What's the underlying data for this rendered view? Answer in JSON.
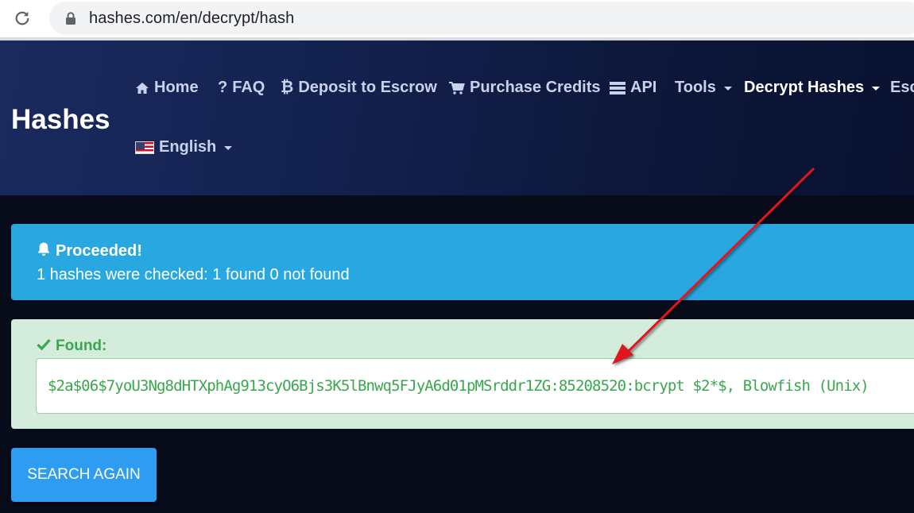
{
  "browser": {
    "url": "hashes.com/en/decrypt/hash"
  },
  "header": {
    "brand": "Hashes",
    "nav": [
      {
        "label": "Home",
        "icon": "home-icon"
      },
      {
        "label": "FAQ",
        "icon": "question-icon"
      },
      {
        "label": "Deposit to Escrow",
        "icon": "bitcoin-icon"
      },
      {
        "label": "Purchase Credits",
        "icon": "cart-icon"
      },
      {
        "label": "API",
        "icon": "server-icon"
      },
      {
        "label": "Tools",
        "dropdown": true
      },
      {
        "label": "Decrypt Hashes",
        "dropdown": true,
        "active": true
      },
      {
        "label": "Esc"
      }
    ],
    "language": {
      "label": "English",
      "icon": "us-flag-icon"
    }
  },
  "alert_info": {
    "title": "Proceeded!",
    "body": "1 hashes were checked: 1 found 0 not found",
    "icon": "bell-icon",
    "color": "#29a7e1"
  },
  "found": {
    "title": "Found:",
    "icon": "check-icon",
    "result": "$2a$06$7yoU3Ng8dHTXphAg913cyO6Bjs3K5lBnwq5FJyA6d01pMSrddr1ZG:85208520:bcrypt $2*$, Blowfish (Unix)",
    "color": "#3aa64e"
  },
  "search_again": {
    "label": "SEARCH AGAIN",
    "color": "#2e9cf0"
  }
}
